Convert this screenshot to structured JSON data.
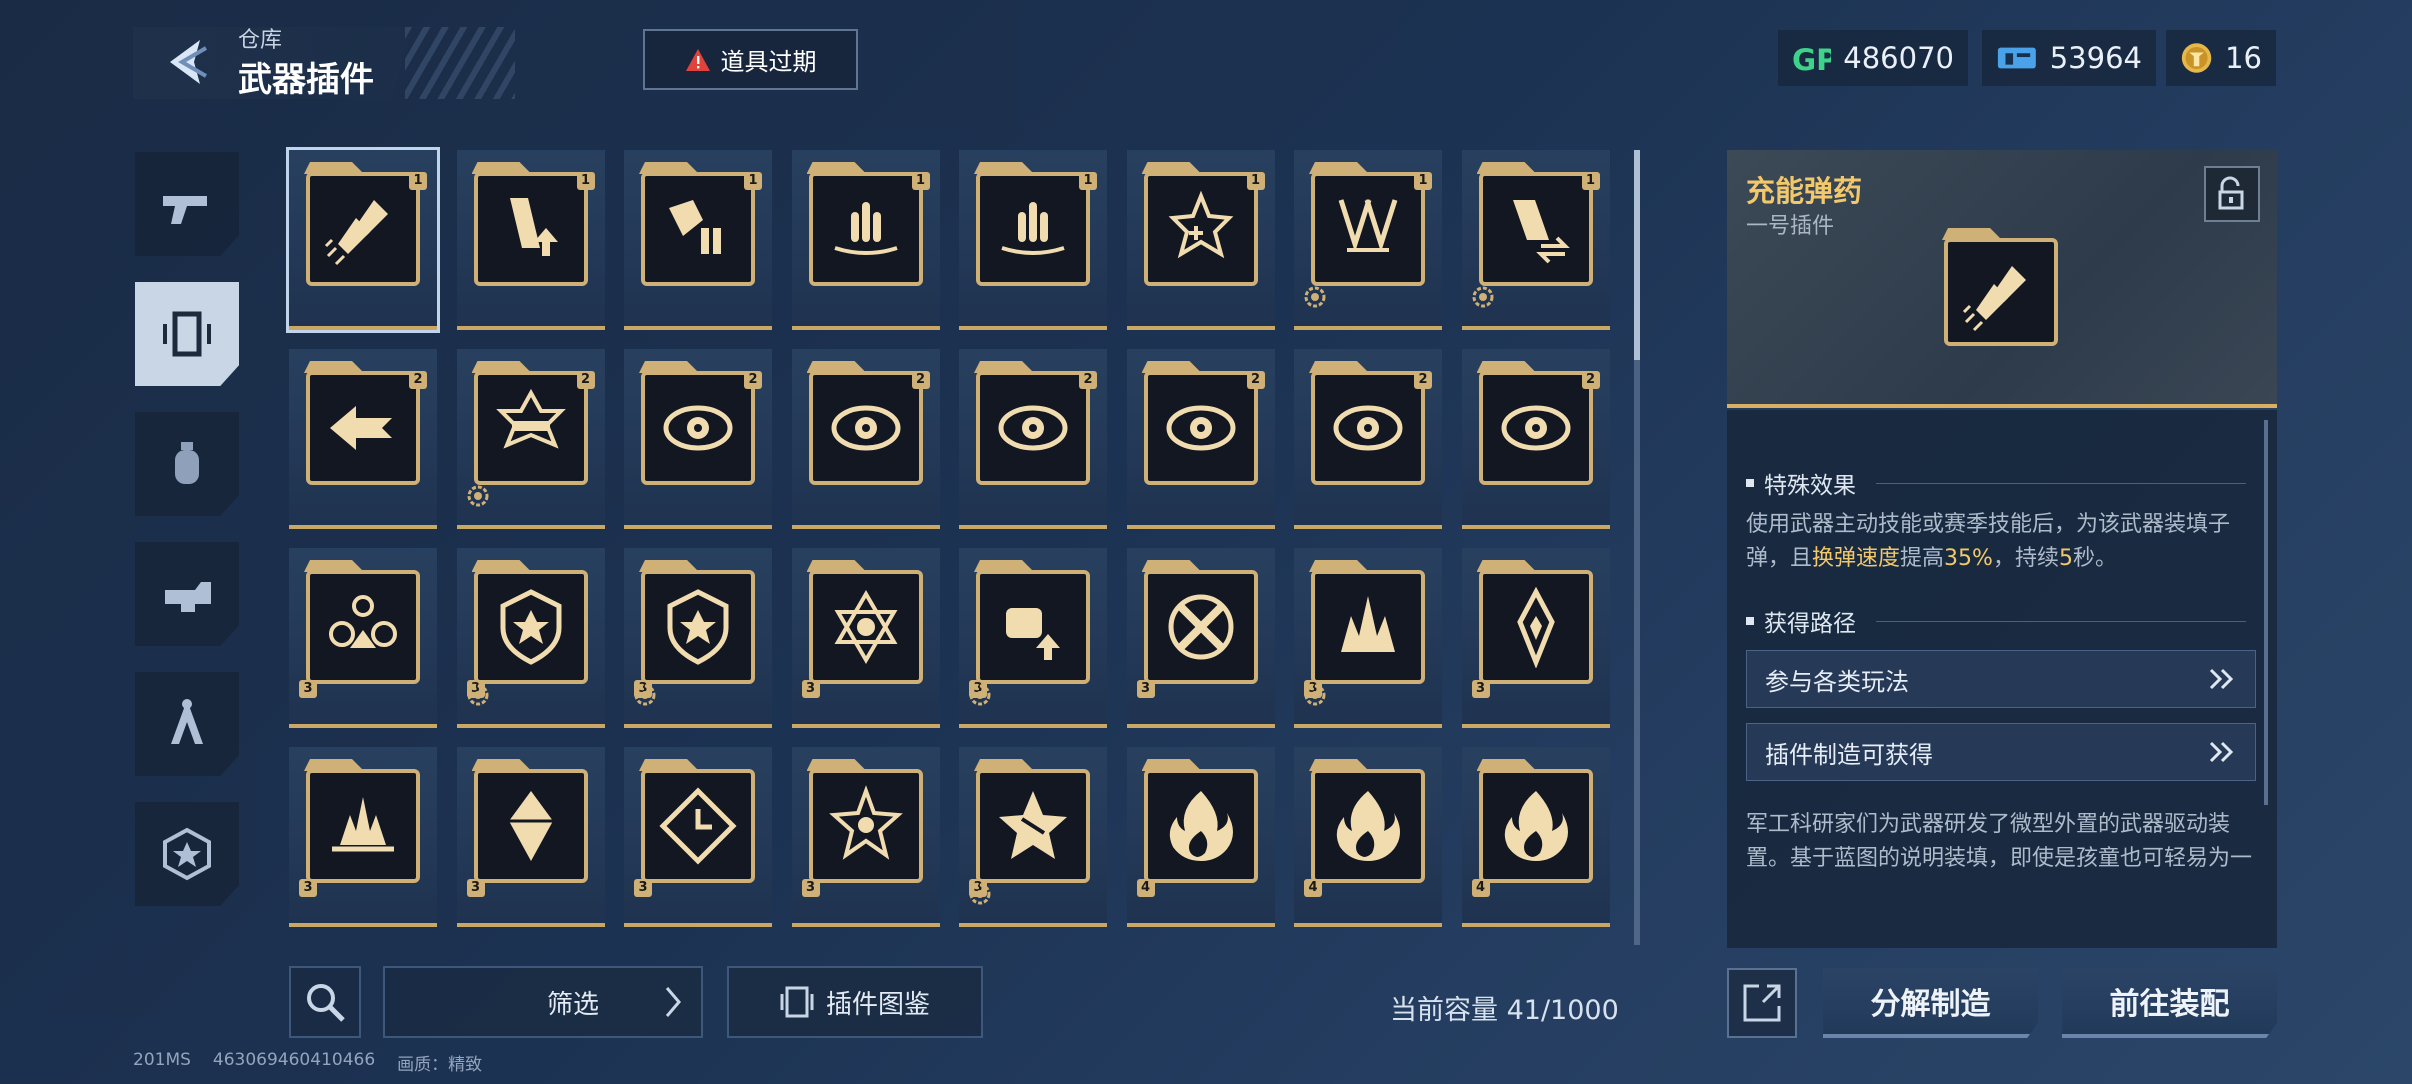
{
  "header": {
    "breadcrumb": "仓库",
    "title": "武器插件",
    "expired_label": "道具过期",
    "currencies": [
      {
        "icon": "gp-icon",
        "value": "486070"
      },
      {
        "icon": "ticket-icon",
        "value": "53964"
      },
      {
        "icon": "coin-icon",
        "value": "16"
      }
    ]
  },
  "side_tabs": [
    {
      "icon": "gun-icon",
      "selected": false
    },
    {
      "icon": "plugin-icon",
      "selected": true
    },
    {
      "icon": "grenade-icon",
      "selected": false
    },
    {
      "icon": "attachment-icon",
      "selected": false
    },
    {
      "icon": "compass-icon",
      "selected": false
    },
    {
      "icon": "star-emblem-icon",
      "selected": false
    }
  ],
  "grid": {
    "items": [
      {
        "icon": "bullets-icon",
        "tier": "1",
        "badge": false
      },
      {
        "icon": "magazine-up-icon",
        "tier": "1",
        "badge": false
      },
      {
        "icon": "armor-rounds-icon",
        "tier": "1",
        "badge": false
      },
      {
        "icon": "triple-rounds-icon",
        "tier": "1",
        "badge": false
      },
      {
        "icon": "triple-rounds-icon",
        "tier": "1",
        "badge": false
      },
      {
        "icon": "rounds-plus-icon",
        "tier": "1",
        "badge": false
      },
      {
        "icon": "arrows-down-icon",
        "tier": "1",
        "badge": true
      },
      {
        "icon": "magazine-swap-icon",
        "tier": "1",
        "badge": true
      },
      {
        "icon": "arrow-burst-icon",
        "tier": "2",
        "badge": false
      },
      {
        "icon": "gun-burst-icon",
        "tier": "2",
        "badge": true
      },
      {
        "icon": "eye-icon",
        "tier": "2",
        "badge": false
      },
      {
        "icon": "eye-icon",
        "tier": "2",
        "badge": false
      },
      {
        "icon": "eye-icon",
        "tier": "2",
        "badge": false
      },
      {
        "icon": "eye-icon",
        "tier": "2",
        "badge": false
      },
      {
        "icon": "eye-icon",
        "tier": "2",
        "badge": false
      },
      {
        "icon": "eye-icon",
        "tier": "2",
        "badge": false
      },
      {
        "icon": "circles-icon",
        "tier": "3",
        "badge": false
      },
      {
        "icon": "shield-burst-icon",
        "tier": "3",
        "badge": true
      },
      {
        "icon": "shield-burst-icon",
        "tier": "3",
        "badge": true
      },
      {
        "icon": "hexagram-icon",
        "tier": "3",
        "badge": false
      },
      {
        "icon": "fist-up-icon",
        "tier": "3",
        "badge": true
      },
      {
        "icon": "cross-bullets-icon",
        "tier": "3",
        "badge": false
      },
      {
        "icon": "claw-up-icon",
        "tier": "3",
        "badge": true
      },
      {
        "icon": "spike-icon",
        "tier": "3",
        "badge": false
      },
      {
        "icon": "ground-burst-icon",
        "tier": "3",
        "badge": false
      },
      {
        "icon": "crystal-icon",
        "tier": "3",
        "badge": false
      },
      {
        "icon": "diamond-clock-icon",
        "tier": "3",
        "badge": false
      },
      {
        "icon": "burst-star-icon",
        "tier": "3",
        "badge": false
      },
      {
        "icon": "star-break-icon",
        "tier": "3",
        "badge": true
      },
      {
        "icon": "flame-icon",
        "tier": "4",
        "badge": false
      },
      {
        "icon": "flame-icon",
        "tier": "4",
        "badge": false
      },
      {
        "icon": "flame-icon",
        "tier": "4",
        "badge": false
      }
    ]
  },
  "toolbar": {
    "filter_label": "筛选",
    "catalog_label": "插件图鉴",
    "capacity": "当前容量 41/1000"
  },
  "footer": {
    "ping": "201MS",
    "uid": "463069460410466",
    "quality": "画质：精致"
  },
  "detail": {
    "name": "充能弹药",
    "subtitle": "一号插件",
    "effect_heading": "特殊效果",
    "effect_pre": "使用武器主动技能或赛季技能后，为该武器装填子弹，且",
    "effect_hl1": "换弹速度",
    "effect_mid": "提高",
    "effect_hl2": "35%",
    "effect_mid2": "，持续",
    "effect_hl3": "5",
    "effect_post": "秒。",
    "source_heading": "获得路径",
    "sources": [
      "参与各类玩法",
      "插件制造可获得"
    ],
    "description": "军工科研家们为武器研发了微型外置的武器驱动装置。基于蓝图的说明装填，即使是孩童也可轻易为一",
    "decompose_label": "分解制造",
    "equip_label": "前往装配"
  }
}
